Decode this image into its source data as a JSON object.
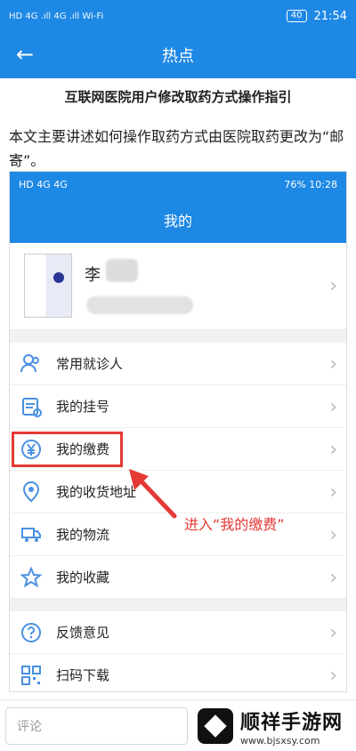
{
  "statusbar": {
    "left": "HD 4G .ıll 4G .ıll Wi-Fi",
    "battery": "40",
    "time": "21:54"
  },
  "header": {
    "back_icon": "←",
    "title": "热点"
  },
  "article": {
    "title": "互联网医院用户修改取药方式操作指引",
    "intro": "本文主要讲述如何操作取药方式由医院取药更改为“邮寄”。"
  },
  "screenshot": {
    "statusbar": {
      "left": "HD 4G 4G",
      "right": "76%  10:28"
    },
    "page_title": "我的",
    "profile": {
      "name": "李"
    },
    "menu_groups": [
      [
        {
          "label": "常用就诊人",
          "icon": "users-icon"
        },
        {
          "label": "我的挂号",
          "icon": "calendar-icon"
        },
        {
          "label": "我的缴费",
          "icon": "yen-icon"
        },
        {
          "label": "我的收货地址",
          "icon": "location-icon"
        },
        {
          "label": "我的物流",
          "icon": "truck-icon"
        },
        {
          "label": "我的收藏",
          "icon": "star-icon"
        }
      ],
      [
        {
          "label": "反馈意见",
          "icon": "question-icon"
        },
        {
          "label": "扫码下载",
          "icon": "qr-icon"
        }
      ]
    ],
    "callout": "进入“我的缴费”",
    "accent": "#1e88e5",
    "highlight_color": "#e53935"
  },
  "bottom": {
    "comment_placeholder": "评论",
    "logo_title": "顺祥手游网",
    "logo_url": "www.bjsxsy.com"
  }
}
